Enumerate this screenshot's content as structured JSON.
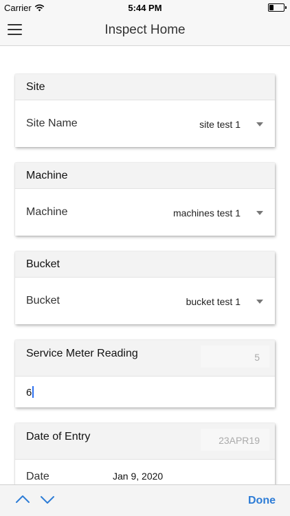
{
  "status_bar": {
    "carrier": "Carrier",
    "time": "5:44 PM"
  },
  "nav": {
    "title": "Inspect Home",
    "menu_icon": "hamburger-menu-icon"
  },
  "cards": {
    "site": {
      "header": "Site",
      "label": "Site Name",
      "value": "site test 1"
    },
    "machine": {
      "header": "Machine",
      "label": "Machine",
      "value": "machines test 1"
    },
    "bucket": {
      "header": "Bucket",
      "label": "Bucket",
      "value": "bucket test 1"
    },
    "service_meter": {
      "header": "Service Meter Reading",
      "hint": "5",
      "input_value": "6"
    },
    "date_entry": {
      "header": "Date of Entry",
      "hint": "23APR19",
      "label": "Date",
      "value": "Jan 9, 2020"
    }
  },
  "toolbar": {
    "done_label": "Done",
    "up_icon": "chevron-up-icon",
    "down_icon": "chevron-down-icon"
  },
  "colors": {
    "accent": "#2d7cd6",
    "cursor": "#2a6ef0"
  }
}
